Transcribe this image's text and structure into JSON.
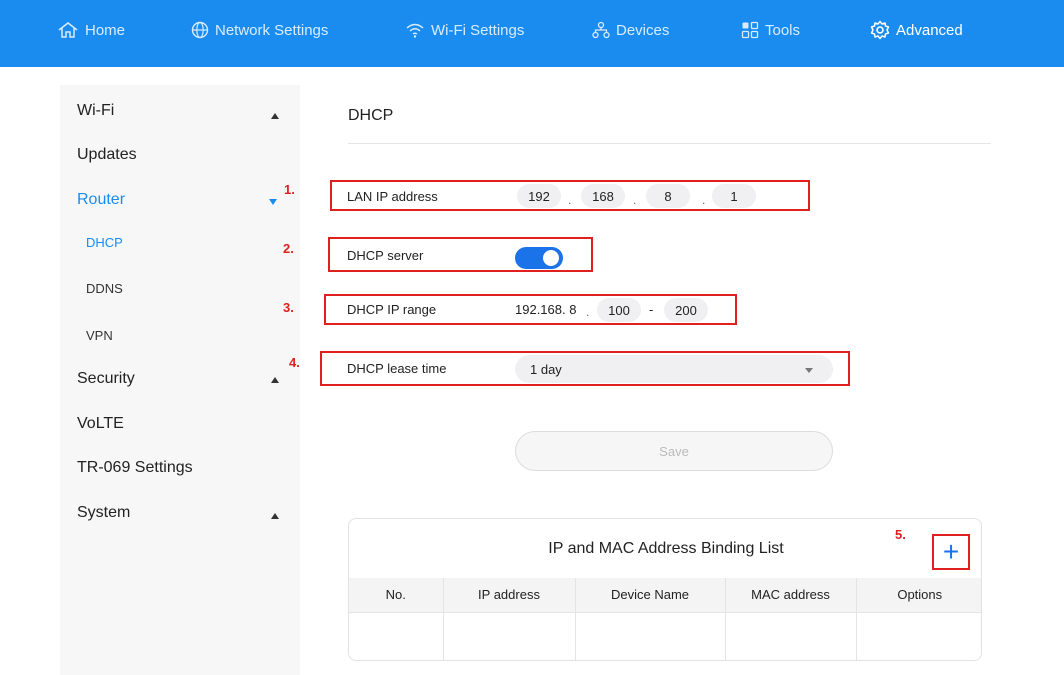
{
  "topnav": [
    {
      "label": "Home",
      "icon": "home-icon"
    },
    {
      "label": "Network Settings",
      "icon": "globe-icon"
    },
    {
      "label": "Wi-Fi Settings",
      "icon": "wifi-icon"
    },
    {
      "label": "Devices",
      "icon": "devices-icon"
    },
    {
      "label": "Tools",
      "icon": "tools-icon"
    },
    {
      "label": "Advanced",
      "icon": "gear-icon"
    }
  ],
  "sidebar": {
    "items": [
      "Wi-Fi",
      "Updates",
      "Router",
      "Security",
      "VoLTE",
      "TR-069 Settings",
      "System"
    ],
    "router_sub": [
      "DHCP",
      "DDNS",
      "VPN"
    ]
  },
  "page": {
    "title": "DHCP"
  },
  "form": {
    "lan_label": "LAN IP address",
    "lan_ip": [
      "192",
      "168",
      "8",
      "1"
    ],
    "dhcp_server_label": "DHCP server",
    "dhcp_server_on": true,
    "range_label": "DHCP IP range",
    "range_prefix": "192.168. 8",
    "range_start": "100",
    "range_end": "200",
    "range_sep": "-",
    "lease_label": "DHCP lease time",
    "lease_value": "1 day",
    "save_label": "Save"
  },
  "annotations": [
    "1.",
    "2.",
    "3.",
    "4.",
    "5."
  ],
  "binding": {
    "title": "IP and MAC Address Binding List",
    "add_symbol": "+",
    "columns": [
      "No.",
      "IP address",
      "Device Name",
      "MAC address",
      "Options"
    ]
  },
  "colors": {
    "accent": "#1a8cf0",
    "highlight": "#e01f1f"
  }
}
